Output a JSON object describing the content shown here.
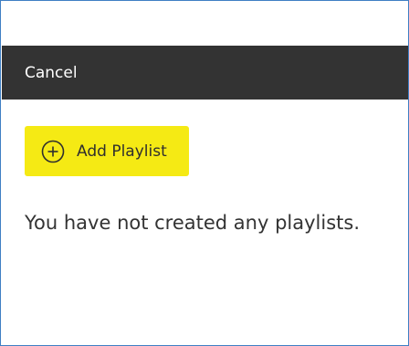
{
  "header": {
    "cancel_label": "Cancel"
  },
  "actions": {
    "add_playlist_label": "Add Playlist",
    "add_playlist_icon": "plus-circle-icon"
  },
  "empty_state": {
    "message": "You have not created any playlists."
  },
  "colors": {
    "frame_border": "#3f7fc4",
    "header_bar": "#333333",
    "button_background": "#f5ea14",
    "text": "#333333"
  }
}
